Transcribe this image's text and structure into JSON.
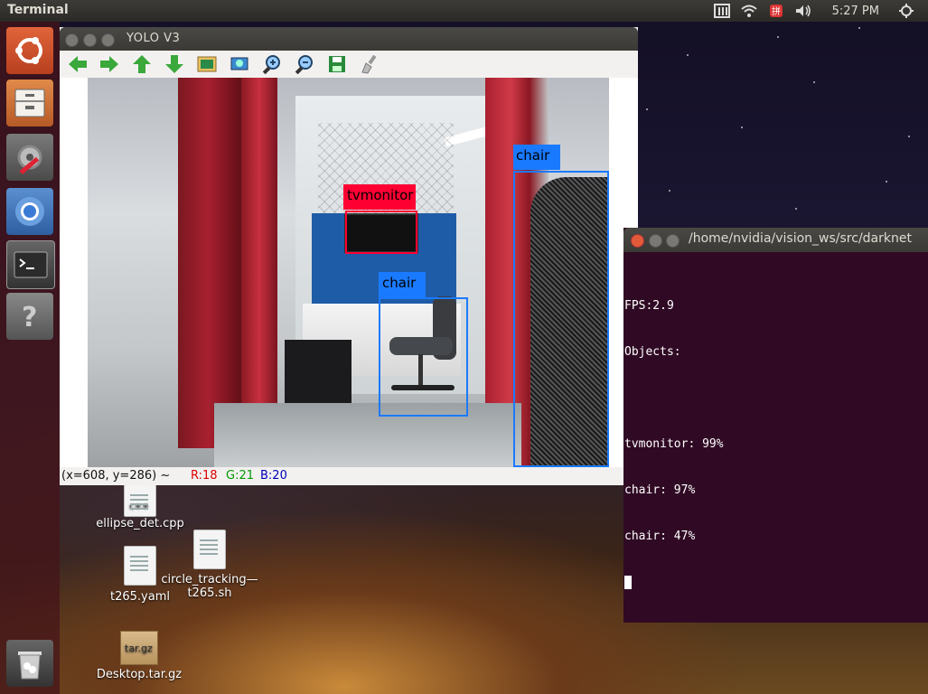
{
  "top_panel": {
    "app_title": "Terminal",
    "clock": "5:27 PM"
  },
  "launcher": {
    "items": [
      "ubuntu-dash",
      "files",
      "system-settings",
      "chromium",
      "terminal",
      "help"
    ],
    "trash": "trash"
  },
  "yolo_window": {
    "title": "YOLO V3",
    "toolbar": [
      "arrow-left-icon",
      "arrow-right-icon",
      "arrow-up-icon",
      "arrow-down-icon",
      "image-icon",
      "zoom-fit-icon",
      "zoom-in-icon",
      "zoom-out-icon",
      "save-icon",
      "brush-icon"
    ],
    "detections": [
      {
        "label": "tvmonitor",
        "color": "#ff0033"
      },
      {
        "label": "chair",
        "color": "#1a7aff"
      },
      {
        "label": "chair",
        "color": "#1a7aff"
      }
    ],
    "status": {
      "coords": "(x=608, y=286) ~",
      "r": "R:18",
      "g": "G:21",
      "b": "B:20"
    }
  },
  "terminal": {
    "title": "/home/nvidia/vision_ws/src/darknet",
    "lines": [
      "FPS:2.9",
      "Objects:",
      "",
      "tvmonitor: 99%",
      "chair: 97%",
      "chair: 47%"
    ]
  },
  "desktop_icons": [
    {
      "name": "ellipse_det.cpp",
      "type": "cpp"
    },
    {
      "name": "t265.yaml",
      "type": "text"
    },
    {
      "name": "circle_tracking—\nt265.sh",
      "type": "text"
    },
    {
      "name": "Desktop.tar.gz",
      "type": "archive"
    }
  ]
}
